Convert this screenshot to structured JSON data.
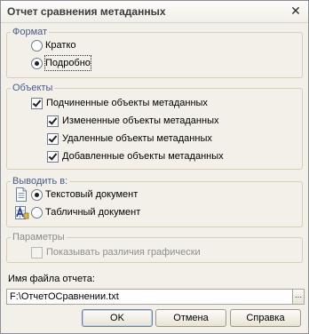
{
  "window": {
    "title": "Отчет сравнения метаданных",
    "close_glyph": "✕"
  },
  "format": {
    "title": "Формат",
    "options": [
      {
        "label": "Кратко",
        "checked": false
      },
      {
        "label": "Подробно",
        "checked": true
      }
    ]
  },
  "objects": {
    "title": "Объекты",
    "main": {
      "label": "Подчиненные объекты метаданных",
      "checked": true
    },
    "items": [
      {
        "label": "Измененные объекты метаданных",
        "checked": true
      },
      {
        "label": "Удаленные объекты метаданных",
        "checked": true
      },
      {
        "label": "Добавленные объекты метаданных",
        "checked": true
      }
    ]
  },
  "output": {
    "title": "Выводить в:",
    "options": [
      {
        "label": "Текстовый документ",
        "checked": true,
        "icon": "text-document-icon"
      },
      {
        "label": "Табличный документ",
        "checked": false,
        "icon": "spreadsheet-document-icon"
      }
    ]
  },
  "params": {
    "title": "Параметры",
    "show_graphic_diff": {
      "label": "Показывать различия графически",
      "checked": false,
      "disabled": true
    }
  },
  "file": {
    "label": "Имя файла отчета:",
    "value": "F:\\ОтчетОСравнении.txt",
    "browse_label": "..."
  },
  "buttons": {
    "ok": "OK",
    "cancel": "Отмена",
    "help": "Справка"
  },
  "colors": {
    "group_title": "#4a5a8a",
    "dialog_bg": "#f2f0e8"
  }
}
